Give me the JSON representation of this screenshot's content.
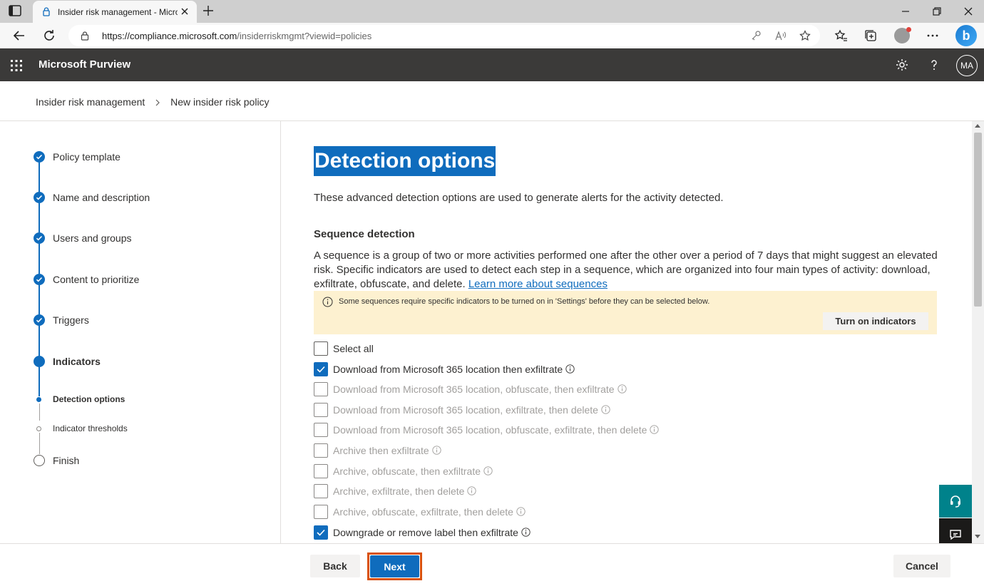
{
  "browser": {
    "tab_title": "Insider risk management - Micro",
    "url_host": "https://compliance.microsoft.com",
    "url_path": "/insiderriskmgmt?viewid=policies"
  },
  "app": {
    "name": "Microsoft Purview",
    "user_initials": "MA"
  },
  "breadcrumb": {
    "root": "Insider risk management",
    "current": "New insider risk policy"
  },
  "steps": [
    {
      "label": "Policy template",
      "state": "completed"
    },
    {
      "label": "Name and description",
      "state": "completed"
    },
    {
      "label": "Users and groups",
      "state": "completed"
    },
    {
      "label": "Content to prioritize",
      "state": "completed"
    },
    {
      "label": "Triggers",
      "state": "completed"
    },
    {
      "label": "Indicators",
      "state": "current"
    },
    {
      "label": "Finish",
      "state": "pending"
    }
  ],
  "substeps": [
    {
      "label": "Detection options",
      "state": "current"
    },
    {
      "label": "Indicator thresholds",
      "state": "pending"
    }
  ],
  "main": {
    "title": "Detection options",
    "intro": "These advanced detection options are used to generate alerts for the activity detected.",
    "section_title": "Sequence detection",
    "section_desc": "A sequence is a group of two or more activities performed one after the other over a period of 7 days that might suggest an elevated risk. Specific indicators are used to detect each step in a sequence, which are organized into four main types of activity: download, exfiltrate, obfuscate, and delete.",
    "learn_more": "Learn more about sequences",
    "banner_message": "Some sequences require specific indicators to be turned on in 'Settings' before they can be selected below.",
    "banner_button": "Turn on indicators",
    "select_all": "Select all",
    "options": [
      {
        "label": "Download from Microsoft 365 location then exfiltrate",
        "checked": true,
        "enabled": true
      },
      {
        "label": "Download from Microsoft 365 location, obfuscate, then exfiltrate",
        "checked": false,
        "enabled": false
      },
      {
        "label": "Download from Microsoft 365 location, exfiltrate, then delete",
        "checked": false,
        "enabled": false
      },
      {
        "label": "Download from Microsoft 365 location, obfuscate, exfiltrate, then delete",
        "checked": false,
        "enabled": false
      },
      {
        "label": "Archive then exfiltrate",
        "checked": false,
        "enabled": false
      },
      {
        "label": "Archive, obfuscate, then exfiltrate",
        "checked": false,
        "enabled": false
      },
      {
        "label": "Archive, exfiltrate, then delete",
        "checked": false,
        "enabled": false
      },
      {
        "label": "Archive, obfuscate, exfiltrate, then delete",
        "checked": false,
        "enabled": false
      },
      {
        "label": "Downgrade or remove label then exfiltrate",
        "checked": true,
        "enabled": true
      }
    ]
  },
  "footer": {
    "back": "Back",
    "next": "Next",
    "cancel": "Cancel"
  },
  "colors": {
    "accent": "#0f6cbd",
    "header_bg": "#3b3a39",
    "banner_bg": "#fdf1d0",
    "highlight_outline": "#d9520f"
  }
}
